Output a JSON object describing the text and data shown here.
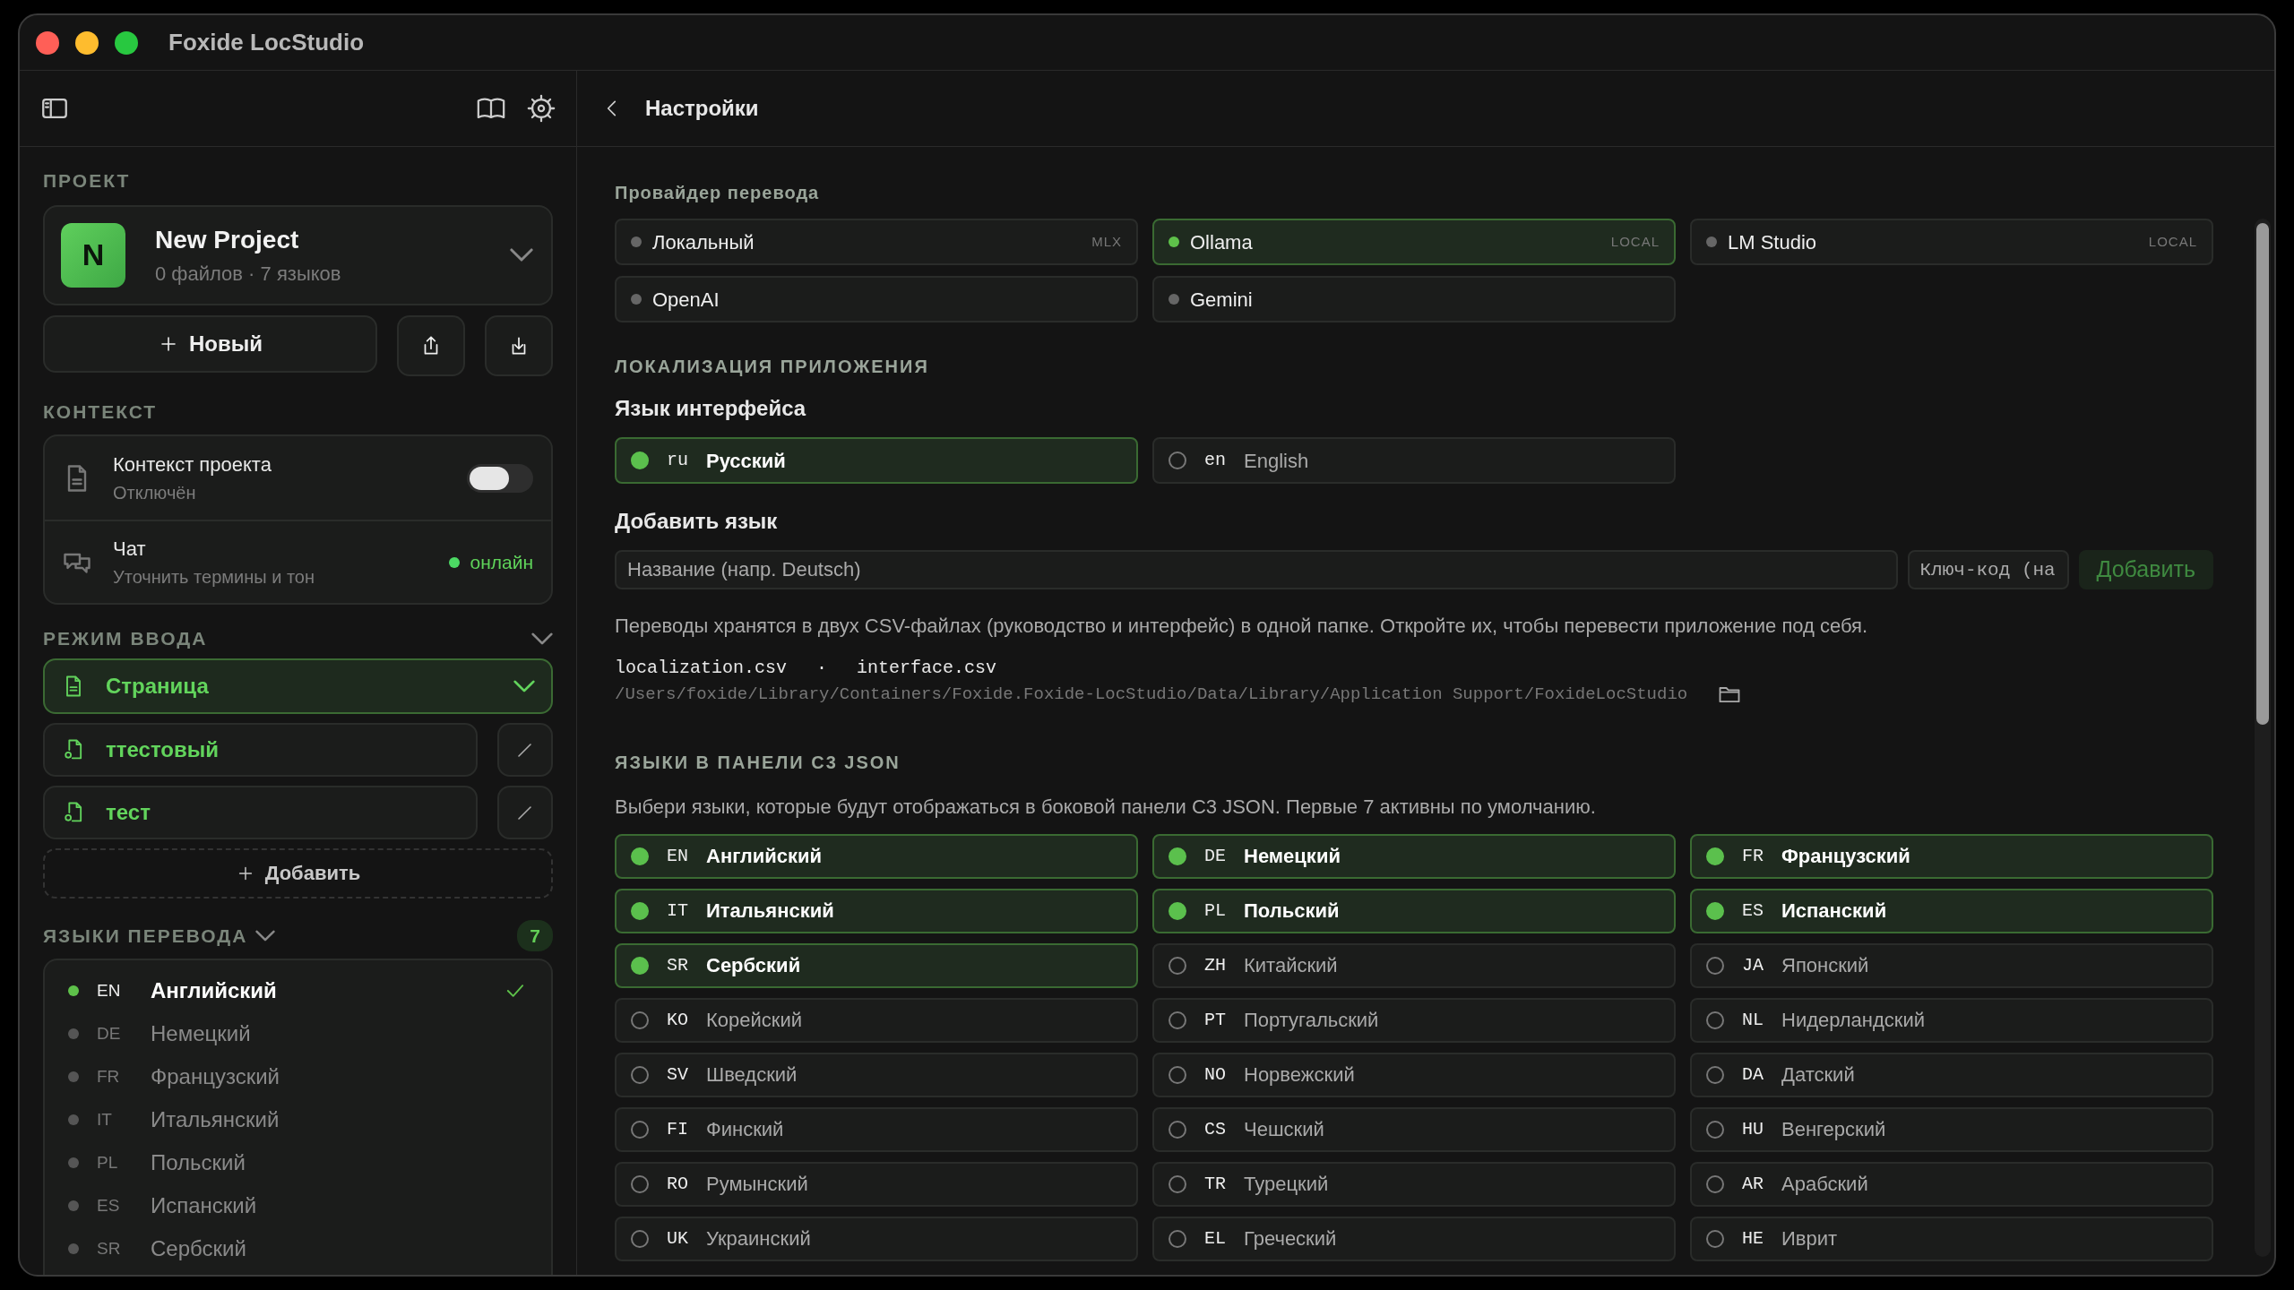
{
  "window": {
    "title": "Foxide LocStudio"
  },
  "sidebar": {
    "project": {
      "label": "ПРОЕКТ",
      "avatar": "N",
      "name": "New Project",
      "meta": "0 файлов · 7 языков",
      "new_button": "Новый"
    },
    "context": {
      "label": "КОНТЕКСТ",
      "items": [
        {
          "kind": "toggle",
          "title": "Контекст проекта",
          "subtitle": "Отключён",
          "on": false
        },
        {
          "kind": "status",
          "title": "Чат",
          "subtitle": "Уточнить термины и тон",
          "status": "онлайн"
        }
      ]
    },
    "input_mode": {
      "label": "РЕЖИМ ВВОДА",
      "items": [
        {
          "kind": "page",
          "label": "Страница",
          "selected": true
        },
        {
          "kind": "custom",
          "label": "ттестовый",
          "selected": false
        },
        {
          "kind": "custom",
          "label": "тест",
          "selected": false
        }
      ],
      "add_button": "Добавить"
    },
    "translation_languages": {
      "label": "ЯЗЫКИ ПЕРЕВОДА",
      "count": "7",
      "items": [
        {
          "code": "EN",
          "name": "Английский",
          "selected": true
        },
        {
          "code": "DE",
          "name": "Немецкий",
          "selected": false
        },
        {
          "code": "FR",
          "name": "Французский",
          "selected": false
        },
        {
          "code": "IT",
          "name": "Итальянский",
          "selected": false
        },
        {
          "code": "PL",
          "name": "Польский",
          "selected": false
        },
        {
          "code": "ES",
          "name": "Испанский",
          "selected": false
        },
        {
          "code": "SR",
          "name": "Сербский",
          "selected": false
        }
      ]
    }
  },
  "main": {
    "title": "Настройки",
    "provider": {
      "label": "Провайдер перевода",
      "options": [
        {
          "name": "Локальный",
          "tag": "MLX",
          "selected": false
        },
        {
          "name": "Ollama",
          "tag": "LOCAL",
          "selected": true
        },
        {
          "name": "LM Studio",
          "tag": "LOCAL",
          "selected": false
        },
        {
          "name": "OpenAI",
          "selected": false
        },
        {
          "name": "Gemini",
          "selected": false
        }
      ]
    },
    "app_localization": {
      "label": "ЛОКАЛИЗАЦИЯ ПРИЛОЖЕНИЯ",
      "interface_language": {
        "label": "Язык интерфейса",
        "options": [
          {
            "code": "ru",
            "name": "Русский",
            "selected": true
          },
          {
            "code": "en",
            "name": "English",
            "selected": false
          }
        ]
      },
      "add_language": {
        "label": "Добавить язык",
        "name_placeholder": "Название (напр. Deutsch)",
        "key_placeholder": "Ключ-код (на",
        "button": "Добавить",
        "disabled": true
      },
      "info": "Переводы хранятся в двух CSV-файлах (руководство и интерфейс) в одной папке. Откройте их, чтобы перевести приложение под себя.",
      "files": [
        "localization.csv",
        "interface.csv"
      ],
      "separator": "·",
      "path": "/Users/foxide/Library/Containers/Foxide.Foxide-LocStudio/Data/Library/Application Support/FoxideLocStudio"
    },
    "c3_languages": {
      "label": "ЯЗЫКИ В ПАНЕЛИ C3 JSON",
      "description": "Выбери языки, которые будут отображаться в боковой панели C3 JSON. Первые 7 активны по умолчанию.",
      "items": [
        {
          "code": "EN",
          "name": "Английский",
          "checked": true
        },
        {
          "code": "DE",
          "name": "Немецкий",
          "checked": true
        },
        {
          "code": "FR",
          "name": "Французский",
          "checked": true
        },
        {
          "code": "IT",
          "name": "Итальянский",
          "checked": true
        },
        {
          "code": "PL",
          "name": "Польский",
          "checked": true
        },
        {
          "code": "ES",
          "name": "Испанский",
          "checked": true
        },
        {
          "code": "SR",
          "name": "Сербский",
          "checked": true
        },
        {
          "code": "ZH",
          "name": "Китайский",
          "checked": false
        },
        {
          "code": "JA",
          "name": "Японский",
          "checked": false
        },
        {
          "code": "KO",
          "name": "Корейский",
          "checked": false
        },
        {
          "code": "PT",
          "name": "Португальский",
          "checked": false
        },
        {
          "code": "NL",
          "name": "Нидерландский",
          "checked": false
        },
        {
          "code": "SV",
          "name": "Шведский",
          "checked": false
        },
        {
          "code": "NO",
          "name": "Норвежский",
          "checked": false
        },
        {
          "code": "DA",
          "name": "Датский",
          "checked": false
        },
        {
          "code": "FI",
          "name": "Финский",
          "checked": false
        },
        {
          "code": "CS",
          "name": "Чешский",
          "checked": false
        },
        {
          "code": "HU",
          "name": "Венгерский",
          "checked": false
        },
        {
          "code": "RO",
          "name": "Румынский",
          "checked": false
        },
        {
          "code": "TR",
          "name": "Турецкий",
          "checked": false
        },
        {
          "code": "AR",
          "name": "Арабский",
          "checked": false
        },
        {
          "code": "UK",
          "name": "Украинский",
          "checked": false
        },
        {
          "code": "EL",
          "name": "Греческий",
          "checked": false
        },
        {
          "code": "HE",
          "name": "Иврит",
          "checked": false
        }
      ]
    }
  }
}
